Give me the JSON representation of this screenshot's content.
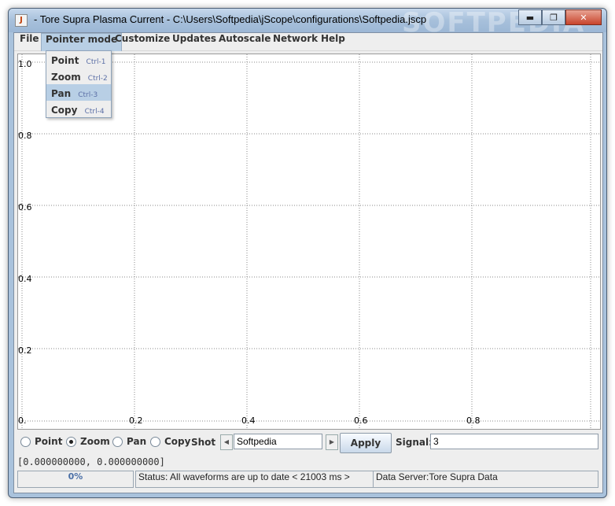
{
  "window": {
    "title": "- Tore Supra Plasma Current - C:\\Users\\Softpedia\\jScope\\configurations\\Softpedia.jscp",
    "watermark": "SOFTPEDIA",
    "minimize": "▬",
    "maximize": "❐",
    "close": "✕"
  },
  "menubar": {
    "items": [
      {
        "label": "File"
      },
      {
        "label": "Pointer mode"
      },
      {
        "label": "Customize"
      },
      {
        "label": "Updates"
      },
      {
        "label": "Autoscale"
      },
      {
        "label": "Network"
      },
      {
        "label": "Help"
      }
    ]
  },
  "pointer_menu": {
    "items": [
      {
        "label": "Point",
        "accel": "Ctrl-1"
      },
      {
        "label": "Zoom",
        "accel": "Ctrl-2"
      },
      {
        "label": "Pan",
        "accel": "Ctrl-3"
      },
      {
        "label": "Copy",
        "accel": "Ctrl-4"
      }
    ]
  },
  "plot": {
    "y_ticks": [
      "1.0",
      "0.8",
      "0.6",
      "0.4",
      "0.2",
      "0."
    ],
    "x_ticks": [
      "0.2",
      "0.4",
      "0.6",
      "0.8"
    ],
    "grid": "dotted"
  },
  "controls": {
    "modes": [
      {
        "label": "Point",
        "selected": false
      },
      {
        "label": "Zoom",
        "selected": true
      },
      {
        "label": "Pan",
        "selected": false
      },
      {
        "label": "Copy",
        "selected": false
      }
    ],
    "shot_label": "Shot",
    "shot_value": "Softpedia",
    "apply_label": "Apply",
    "signal_label": "Signal:",
    "signal_value": "3",
    "prev_arrow": "◀",
    "next_arrow": "▶"
  },
  "coords_text": "[0.000000000, 0.000000000]",
  "statusbar": {
    "progress_text": "0%",
    "status_text": "Status: All waveforms are up to date < 21003 ms >",
    "server_text": "Data Server:Tore Supra Data"
  },
  "colors": {
    "titlebar": "#a7c0db",
    "menu_highlight": "#b8cfe5",
    "progress_text": "#4a6fa6"
  }
}
